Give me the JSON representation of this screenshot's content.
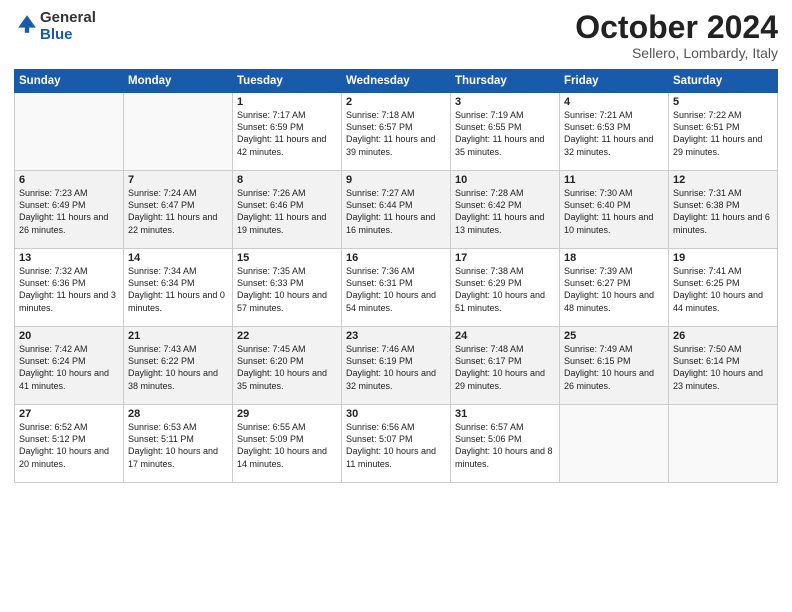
{
  "header": {
    "logo_general": "General",
    "logo_blue": "Blue",
    "title": "October 2024",
    "location": "Sellero, Lombardy, Italy"
  },
  "weekdays": [
    "Sunday",
    "Monday",
    "Tuesday",
    "Wednesday",
    "Thursday",
    "Friday",
    "Saturday"
  ],
  "weeks": [
    [
      {
        "day": "",
        "info": ""
      },
      {
        "day": "",
        "info": ""
      },
      {
        "day": "1",
        "info": "Sunrise: 7:17 AM\nSunset: 6:59 PM\nDaylight: 11 hours and 42 minutes."
      },
      {
        "day": "2",
        "info": "Sunrise: 7:18 AM\nSunset: 6:57 PM\nDaylight: 11 hours and 39 minutes."
      },
      {
        "day": "3",
        "info": "Sunrise: 7:19 AM\nSunset: 6:55 PM\nDaylight: 11 hours and 35 minutes."
      },
      {
        "day": "4",
        "info": "Sunrise: 7:21 AM\nSunset: 6:53 PM\nDaylight: 11 hours and 32 minutes."
      },
      {
        "day": "5",
        "info": "Sunrise: 7:22 AM\nSunset: 6:51 PM\nDaylight: 11 hours and 29 minutes."
      }
    ],
    [
      {
        "day": "6",
        "info": "Sunrise: 7:23 AM\nSunset: 6:49 PM\nDaylight: 11 hours and 26 minutes."
      },
      {
        "day": "7",
        "info": "Sunrise: 7:24 AM\nSunset: 6:47 PM\nDaylight: 11 hours and 22 minutes."
      },
      {
        "day": "8",
        "info": "Sunrise: 7:26 AM\nSunset: 6:46 PM\nDaylight: 11 hours and 19 minutes."
      },
      {
        "day": "9",
        "info": "Sunrise: 7:27 AM\nSunset: 6:44 PM\nDaylight: 11 hours and 16 minutes."
      },
      {
        "day": "10",
        "info": "Sunrise: 7:28 AM\nSunset: 6:42 PM\nDaylight: 11 hours and 13 minutes."
      },
      {
        "day": "11",
        "info": "Sunrise: 7:30 AM\nSunset: 6:40 PM\nDaylight: 11 hours and 10 minutes."
      },
      {
        "day": "12",
        "info": "Sunrise: 7:31 AM\nSunset: 6:38 PM\nDaylight: 11 hours and 6 minutes."
      }
    ],
    [
      {
        "day": "13",
        "info": "Sunrise: 7:32 AM\nSunset: 6:36 PM\nDaylight: 11 hours and 3 minutes."
      },
      {
        "day": "14",
        "info": "Sunrise: 7:34 AM\nSunset: 6:34 PM\nDaylight: 11 hours and 0 minutes."
      },
      {
        "day": "15",
        "info": "Sunrise: 7:35 AM\nSunset: 6:33 PM\nDaylight: 10 hours and 57 minutes."
      },
      {
        "day": "16",
        "info": "Sunrise: 7:36 AM\nSunset: 6:31 PM\nDaylight: 10 hours and 54 minutes."
      },
      {
        "day": "17",
        "info": "Sunrise: 7:38 AM\nSunset: 6:29 PM\nDaylight: 10 hours and 51 minutes."
      },
      {
        "day": "18",
        "info": "Sunrise: 7:39 AM\nSunset: 6:27 PM\nDaylight: 10 hours and 48 minutes."
      },
      {
        "day": "19",
        "info": "Sunrise: 7:41 AM\nSunset: 6:25 PM\nDaylight: 10 hours and 44 minutes."
      }
    ],
    [
      {
        "day": "20",
        "info": "Sunrise: 7:42 AM\nSunset: 6:24 PM\nDaylight: 10 hours and 41 minutes."
      },
      {
        "day": "21",
        "info": "Sunrise: 7:43 AM\nSunset: 6:22 PM\nDaylight: 10 hours and 38 minutes."
      },
      {
        "day": "22",
        "info": "Sunrise: 7:45 AM\nSunset: 6:20 PM\nDaylight: 10 hours and 35 minutes."
      },
      {
        "day": "23",
        "info": "Sunrise: 7:46 AM\nSunset: 6:19 PM\nDaylight: 10 hours and 32 minutes."
      },
      {
        "day": "24",
        "info": "Sunrise: 7:48 AM\nSunset: 6:17 PM\nDaylight: 10 hours and 29 minutes."
      },
      {
        "day": "25",
        "info": "Sunrise: 7:49 AM\nSunset: 6:15 PM\nDaylight: 10 hours and 26 minutes."
      },
      {
        "day": "26",
        "info": "Sunrise: 7:50 AM\nSunset: 6:14 PM\nDaylight: 10 hours and 23 minutes."
      }
    ],
    [
      {
        "day": "27",
        "info": "Sunrise: 6:52 AM\nSunset: 5:12 PM\nDaylight: 10 hours and 20 minutes."
      },
      {
        "day": "28",
        "info": "Sunrise: 6:53 AM\nSunset: 5:11 PM\nDaylight: 10 hours and 17 minutes."
      },
      {
        "day": "29",
        "info": "Sunrise: 6:55 AM\nSunset: 5:09 PM\nDaylight: 10 hours and 14 minutes."
      },
      {
        "day": "30",
        "info": "Sunrise: 6:56 AM\nSunset: 5:07 PM\nDaylight: 10 hours and 11 minutes."
      },
      {
        "day": "31",
        "info": "Sunrise: 6:57 AM\nSunset: 5:06 PM\nDaylight: 10 hours and 8 minutes."
      },
      {
        "day": "",
        "info": ""
      },
      {
        "day": "",
        "info": ""
      }
    ]
  ]
}
